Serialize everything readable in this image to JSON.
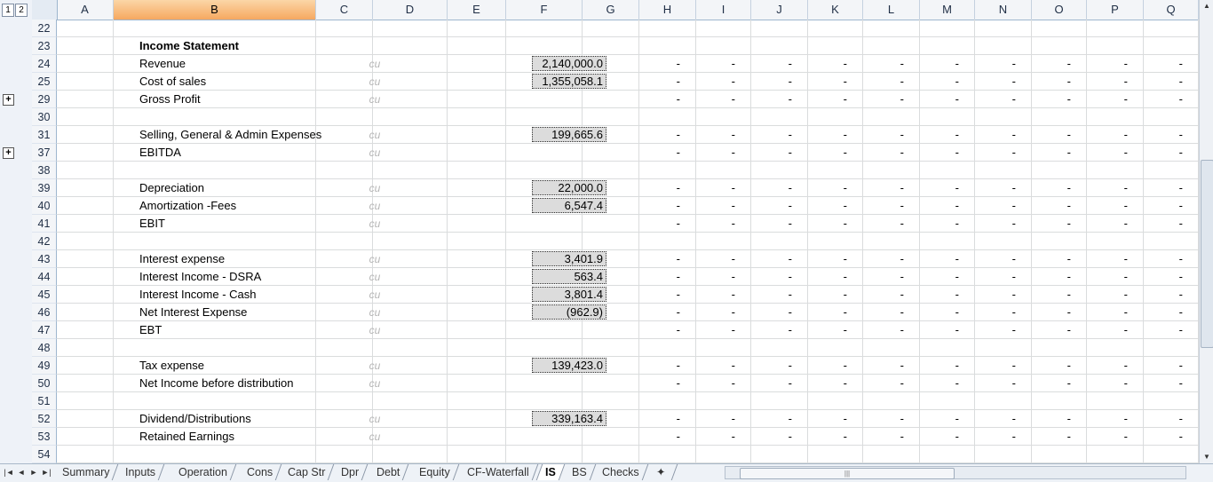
{
  "outline": {
    "levels": [
      "1",
      "2"
    ],
    "expand_symbol": "+"
  },
  "columns": [
    "A",
    "B",
    "C",
    "D",
    "E",
    "F",
    "G",
    "H",
    "I",
    "J",
    "K",
    "L",
    "M",
    "N",
    "O",
    "P",
    "Q"
  ],
  "selected_column": "B",
  "rows": [
    {
      "num": "22",
      "label": "",
      "unit": "",
      "value": "",
      "dashes": false,
      "bold": false,
      "expand": false
    },
    {
      "num": "23",
      "label": "Income Statement",
      "unit": "",
      "value": "",
      "dashes": false,
      "bold": true,
      "expand": false
    },
    {
      "num": "24",
      "label": "Revenue",
      "unit": "cu",
      "value": "2,140,000.0",
      "dashes": true,
      "bold": false,
      "expand": false
    },
    {
      "num": "25",
      "label": "Cost of sales",
      "unit": "cu",
      "value": "1,355,058.1",
      "dashes": true,
      "bold": false,
      "expand": false
    },
    {
      "num": "29",
      "label": "Gross Profit",
      "unit": "cu",
      "value": "",
      "dashes": true,
      "bold": false,
      "expand": true
    },
    {
      "num": "30",
      "label": "",
      "unit": "",
      "value": "",
      "dashes": false,
      "bold": false,
      "expand": false
    },
    {
      "num": "31",
      "label": "Selling, General & Admin Expenses",
      "unit": "cu",
      "value": "199,665.6",
      "dashes": true,
      "bold": false,
      "expand": false
    },
    {
      "num": "37",
      "label": "EBITDA",
      "unit": "cu",
      "value": "",
      "dashes": true,
      "bold": false,
      "expand": true
    },
    {
      "num": "38",
      "label": "",
      "unit": "",
      "value": "",
      "dashes": false,
      "bold": false,
      "expand": false
    },
    {
      "num": "39",
      "label": "Depreciation",
      "unit": "cu",
      "value": "22,000.0",
      "dashes": true,
      "bold": false,
      "expand": false
    },
    {
      "num": "40",
      "label": "Amortization -Fees",
      "unit": "cu",
      "value": "6,547.4",
      "dashes": true,
      "bold": false,
      "expand": false
    },
    {
      "num": "41",
      "label": "EBIT",
      "unit": "cu",
      "value": "",
      "dashes": true,
      "bold": false,
      "expand": false
    },
    {
      "num": "42",
      "label": "",
      "unit": "",
      "value": "",
      "dashes": false,
      "bold": false,
      "expand": false
    },
    {
      "num": "43",
      "label": "Interest expense",
      "unit": "cu",
      "value": "3,401.9",
      "dashes": true,
      "bold": false,
      "expand": false
    },
    {
      "num": "44",
      "label": "Interest Income - DSRA",
      "unit": "cu",
      "value": "563.4",
      "dashes": true,
      "bold": false,
      "expand": false
    },
    {
      "num": "45",
      "label": "Interest Income - Cash",
      "unit": "cu",
      "value": "3,801.4",
      "dashes": true,
      "bold": false,
      "expand": false
    },
    {
      "num": "46",
      "label": "Net Interest Expense",
      "unit": "cu",
      "value": "(962.9)",
      "dashes": true,
      "bold": false,
      "expand": false
    },
    {
      "num": "47",
      "label": "EBT",
      "unit": "cu",
      "value": "",
      "dashes": true,
      "bold": false,
      "expand": false
    },
    {
      "num": "48",
      "label": "",
      "unit": "",
      "value": "",
      "dashes": false,
      "bold": false,
      "expand": false
    },
    {
      "num": "49",
      "label": "Tax expense",
      "unit": "cu",
      "value": "139,423.0",
      "dashes": true,
      "bold": false,
      "expand": false
    },
    {
      "num": "50",
      "label": "Net Income before distribution",
      "unit": "cu",
      "value": "",
      "dashes": true,
      "bold": false,
      "expand": false
    },
    {
      "num": "51",
      "label": "",
      "unit": "",
      "value": "",
      "dashes": false,
      "bold": false,
      "expand": false
    },
    {
      "num": "52",
      "label": "Dividend/Distributions",
      "unit": "cu",
      "value": "339,163.4",
      "dashes": true,
      "bold": false,
      "expand": false
    },
    {
      "num": "53",
      "label": "Retained Earnings",
      "unit": "cu",
      "value": "",
      "dashes": true,
      "bold": false,
      "expand": false
    },
    {
      "num": "54",
      "label": "",
      "unit": "",
      "value": "",
      "dashes": false,
      "bold": false,
      "expand": false
    }
  ],
  "dash_text": "-",
  "sheet_tabs": [
    "Summary",
    "Inputs",
    "Operation",
    "Cons",
    "Cap Str",
    "Dpr",
    "Debt",
    "Equity",
    "CF-Waterfall",
    "IS",
    "BS",
    "Checks"
  ],
  "active_tab": "IS",
  "colors": {
    "selected_header": "#f8bd7e",
    "value_fill": "#dcdcdc",
    "unit_text": "#b6b6b6"
  }
}
